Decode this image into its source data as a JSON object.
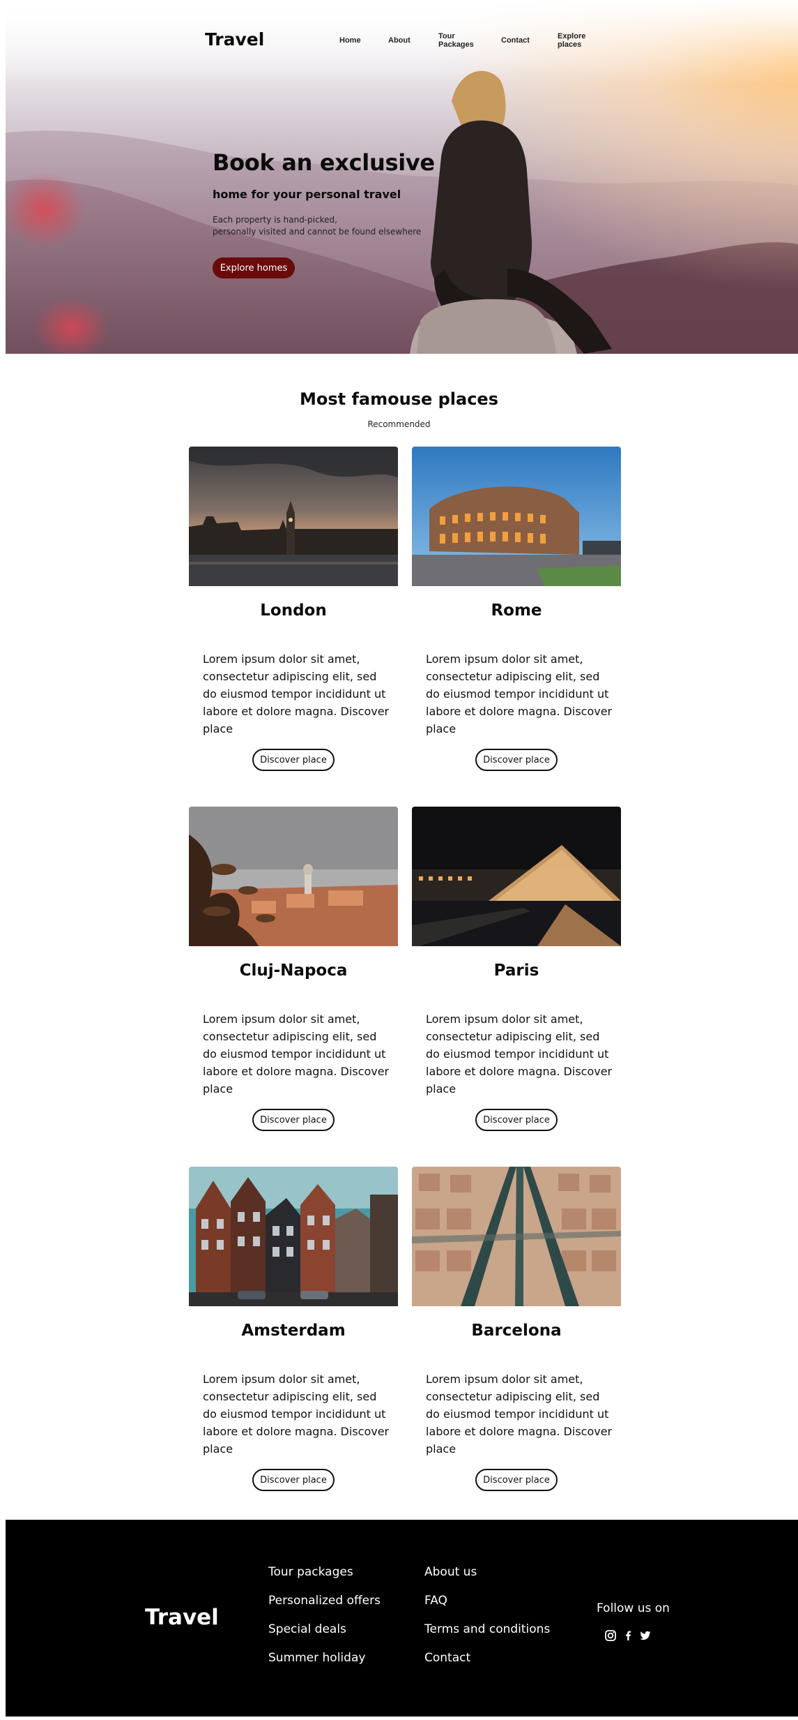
{
  "nav": {
    "logo": "Travel",
    "links": [
      {
        "line1": "Home",
        "line2": ""
      },
      {
        "line1": "About",
        "line2": ""
      },
      {
        "line1": "Tour",
        "line2": "Packages"
      },
      {
        "line1": "Contact",
        "line2": ""
      },
      {
        "line1": "Explore",
        "line2": "places"
      }
    ]
  },
  "hero": {
    "headline": "Book an exclusive",
    "subheadline": "home for your personal travel",
    "paragraph_line1": "Each property is hand-picked,",
    "paragraph_line2": "personally visited and cannot be found elsewhere",
    "button": "Explore homes"
  },
  "places": {
    "title": "Most famouse places",
    "subtitle": "Recommended",
    "cards": [
      {
        "city": "London",
        "description": "Lorem ipsum dolor sit amet, consectetur adipiscing elit, sed do eiusmod tempor incididunt ut labore et dolore magna. Discover place",
        "button": "Discover place"
      },
      {
        "city": "Rome",
        "description": "Lorem ipsum dolor sit amet, consectetur adipiscing elit, sed do eiusmod tempor incididunt ut labore et dolore magna. Discover place",
        "button": "Discover place"
      },
      {
        "city": "Cluj-Napoca",
        "description": "Lorem ipsum dolor sit amet, consectetur adipiscing elit, sed do eiusmod tempor incididunt ut labore et dolore magna. Discover place",
        "button": "Discover place"
      },
      {
        "city": "Paris",
        "description": "Lorem ipsum dolor sit amet, consectetur adipiscing elit, sed do eiusmod tempor incididunt ut labore et dolore magna. Discover place",
        "button": "Discover place"
      },
      {
        "city": "Amsterdam",
        "description": "Lorem ipsum dolor sit amet, consectetur adipiscing elit, sed do eiusmod tempor incididunt ut labore et dolore magna. Discover place",
        "button": "Discover place"
      },
      {
        "city": "Barcelona",
        "description": "Lorem ipsum dolor sit amet, consectetur adipiscing elit, sed do eiusmod tempor incididunt ut labore et dolore magna. Discover place",
        "button": "Discover place"
      }
    ]
  },
  "footer": {
    "logo": "Travel",
    "col1": [
      "Tour packages",
      "Personalized offers",
      "Special deals",
      "Summer holiday"
    ],
    "col2": [
      "About us",
      "FAQ",
      "Terms and conditions",
      "Contact"
    ],
    "follow": "Follow us on",
    "social_icons": [
      "instagram-icon",
      "facebook-icon",
      "twitter-icon"
    ]
  },
  "colors": {
    "accent_button": "#6a0a0a",
    "footer_bg": "#000000",
    "text": "#0b0b0b"
  }
}
